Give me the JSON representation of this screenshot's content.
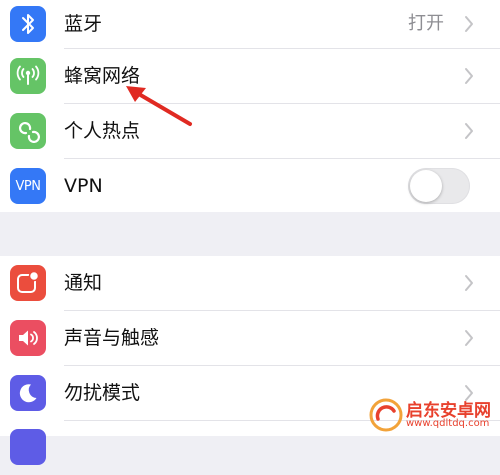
{
  "colors": {
    "bluetooth": "#3478f6",
    "cellular": "#65c466",
    "hotspot": "#65c466",
    "vpn": "#3478f6",
    "notifications": "#eb4d3d",
    "sounds": "#eb4e61",
    "dnd": "#5e5ce6",
    "screen_time": "#5e5ce6",
    "arrow": "#e02a22",
    "watermark": "#e8412d"
  },
  "group1": {
    "bluetooth": {
      "label": "蓝牙",
      "value": "打开",
      "icon": "bluetooth-icon"
    },
    "cellular": {
      "label": "蜂窝网络",
      "icon": "antenna-icon"
    },
    "hotspot": {
      "label": "个人热点",
      "icon": "chain-link-icon"
    },
    "vpn": {
      "label": "VPN",
      "icon_text": "VPN",
      "toggle": "off"
    }
  },
  "group2": {
    "notifications": {
      "label": "通知",
      "icon": "notification-icon"
    },
    "sounds": {
      "label": "声音与触感",
      "icon": "speaker-icon"
    },
    "dnd": {
      "label": "勿扰模式",
      "icon": "moon-icon"
    }
  },
  "watermark": {
    "title": "启东安卓网",
    "url": "www.qdltdq.com"
  }
}
